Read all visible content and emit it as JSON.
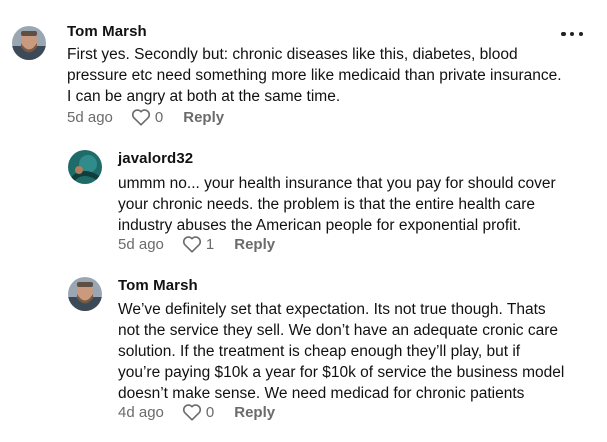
{
  "comments": [
    {
      "author": "Tom  Marsh",
      "avatar": "avatar-photo-man-beard",
      "lines": [
        "First yes. Secondly but: chronic diseases like this, diabetes, blood",
        "pressure etc need something more like medicaid than private insurance.",
        "I can be angry at both at the same time."
      ],
      "time": "5d ago",
      "likes": "0",
      "reply_label": "Reply"
    },
    {
      "author": "javalord32",
      "avatar": "avatar-photo-teal",
      "lines": [
        "ummm no... your health insurance that you pay for should cover",
        "your chronic needs. the problem is that the entire health care",
        "industry abuses the American people for exponential profit."
      ],
      "time": "5d ago",
      "likes": "1",
      "reply_label": "Reply"
    },
    {
      "author": "Tom  Marsh",
      "avatar": "avatar-photo-man-beard",
      "lines": [
        "We’ve definitely set that expectation. Its not true though. Thats",
        "not the service they sell. We don’t have an adequate cronic care",
        "solution. If the treatment is cheap enough they’ll play, but if",
        "you’re paying $10k a year for $10k of service the business model",
        "doesn’t make sense. We need medicad for chronic patients"
      ],
      "time": "4d ago",
      "likes": "0",
      "reply_label": "Reply"
    }
  ],
  "colors": {
    "text": "#111111",
    "muted": "#6b6b6b",
    "background": "#ffffff"
  },
  "icons": {
    "like": "heart-outline-icon",
    "more": "more-horizontal-icon"
  }
}
